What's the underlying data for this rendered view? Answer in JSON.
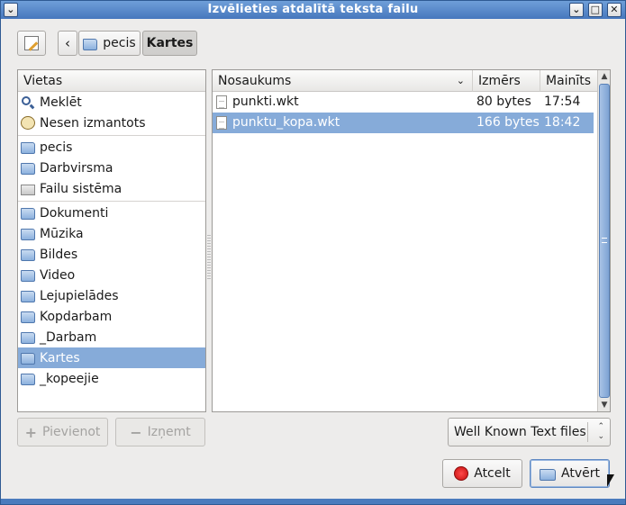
{
  "window": {
    "title": "Izvēlieties atdalītā teksta failu"
  },
  "path_bar": {
    "crumbs": [
      "pecis",
      "Kartes"
    ]
  },
  "places": {
    "header": "Vietas",
    "items": [
      {
        "label": "Meklēt",
        "icon": "search-icon"
      },
      {
        "label": "Nesen izmantots",
        "icon": "recent-clock-icon"
      },
      {
        "label": "pecis",
        "icon": "home-folder-icon"
      },
      {
        "label": "Darbvirsma",
        "icon": "desktop-folder-icon"
      },
      {
        "label": "Failu sistēma",
        "icon": "filesystem-drive-icon"
      },
      {
        "label": "Dokumenti",
        "icon": "documents-folder-icon"
      },
      {
        "label": "Mūzika",
        "icon": "music-folder-icon"
      },
      {
        "label": "Bildes",
        "icon": "pictures-folder-icon"
      },
      {
        "label": "Video",
        "icon": "video-folder-icon"
      },
      {
        "label": "Lejupielādes",
        "icon": "downloads-folder-icon"
      },
      {
        "label": "Kopdarbam",
        "icon": "folder-icon"
      },
      {
        "label": "_Darbam",
        "icon": "folder-icon"
      },
      {
        "label": "Kartes",
        "icon": "folder-icon"
      },
      {
        "label": "_kopeejie",
        "icon": "folder-icon"
      }
    ],
    "add_label": "Pievienot",
    "remove_label": "Izņemt"
  },
  "files": {
    "columns": {
      "name": "Nosaukums",
      "size": "Izmērs",
      "modified": "Mainīts"
    },
    "rows": [
      {
        "name": "punkti.wkt",
        "size": "80 bytes",
        "modified": "17:54"
      },
      {
        "name": "punktu_kopa.wkt",
        "size": "166 bytes",
        "modified": "18:42"
      }
    ]
  },
  "filter": {
    "selected": "Well Known Text files"
  },
  "actions": {
    "cancel_label": "Atcelt",
    "open_label": "Atvērt"
  },
  "colors": {
    "titlebar": "#4677bd",
    "selection": "#86abd9",
    "window_bg": "#edeceb"
  }
}
